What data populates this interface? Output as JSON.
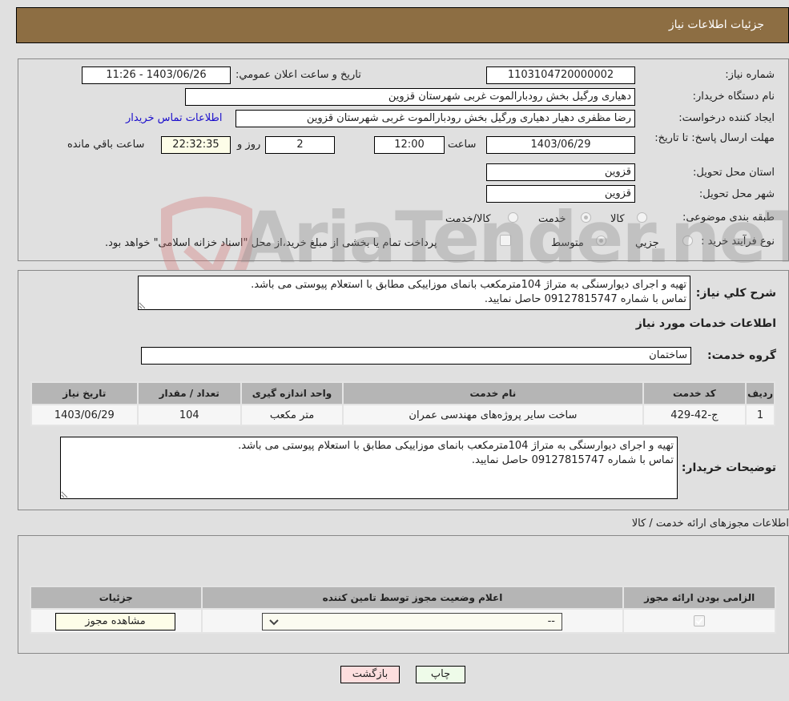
{
  "header": {
    "title": "جزئیات اطلاعات نیاز"
  },
  "form": {
    "need_number_label": "شماره نیاز:",
    "need_number": "1103104720000002",
    "announce_label": "تاريخ و ساعت اعلان عمومي:",
    "announce_value": "1403/06/26 - 11:26",
    "buyer_org_label": "نام دستگاه خريدار:",
    "buyer_org": "دهیاری ورگیل بخش رودبارالموت غربی شهرستان قزوین",
    "creator_label": "ایجاد کننده درخواست:",
    "creator": "رضا مظفری دهیار دهیاری ورگیل بخش رودبارالموت غربی شهرستان قزوین",
    "contact_link": "اطلاعات تماس خريدار",
    "deadline_label": "مهلت ارسال پاسخ: تا تاريخ:",
    "deadline_date": "1403/06/29",
    "time_label": "ساعت",
    "deadline_time": "12:00",
    "days_value": "2",
    "days_label": "روز و",
    "remaining_time": "22:32:35",
    "remaining_label": "ساعت باقي مانده",
    "province_label": "استان محل تحويل:",
    "province": "قزوین",
    "city_label": "شهر محل تحويل:",
    "city": "قزوین",
    "category_label": "طبقه بندی موضوعی:",
    "category_options": [
      "کالا",
      "خدمت",
      "کالا/خدمت"
    ],
    "category_selected": "خدمت",
    "process_label": "نوع فرآیند خرید :",
    "process_options": [
      "جزيي",
      "متوسط"
    ],
    "process_selected": "متوسط",
    "treasury_note": "پرداخت تمام يا بخشی از مبلغ خريد،از محل \"اسناد خزانه اسلامی\" خواهد بود."
  },
  "description": {
    "label": "شرح کلي نياز:",
    "text": "تهيه و اجرای دیوارسنگی به متراژ 104مترمکعب بانمای موزاییکی مطابق با استعلام پیوستی می باشد.\nتماس با شماره 09127815747 حاصل نمایید."
  },
  "services_section": {
    "title": "اطلاعات خدمات مورد نياز",
    "group_label": "گروه خدمت:",
    "group_value": "ساختمان",
    "table": {
      "headers": [
        "رديف",
        "کد خدمت",
        "نام خدمت",
        "واحد اندازه گيری",
        "تعداد / مقدار",
        "تاريخ نياز"
      ],
      "rows": [
        [
          "1",
          "ج-42-429",
          "ساخت سایر پروژه‌های مهندسی عمران",
          "متر مکعب",
          "104",
          "1403/06/29"
        ]
      ]
    }
  },
  "buyer_notes": {
    "label": "توضيحات خريدار:",
    "text": "تهيه و اجرای دیوارسنگی به متراژ 104مترمکعب بانمای موزاییکی مطابق با استعلام پیوستی می باشد.\nتماس با شماره 09127815747 حاصل نمایید."
  },
  "permits": {
    "title": "اطلاعات مجوزهای ارائه خدمت / کالا",
    "headers": [
      "الزامی بودن ارائه مجوز",
      "اعلام وضعيت مجوز توسط تامين کننده",
      "جزئيات"
    ],
    "row": {
      "required_checked": true,
      "status_value": "--",
      "details_button": "مشاهده مجوز"
    }
  },
  "footer": {
    "print_button": "چاپ",
    "back_button": "بازگشت"
  },
  "watermark": {
    "text": "AriaTender.neT"
  },
  "colors": {
    "header_bg": "#8d6e43",
    "print_bg": "#eefbe9",
    "back_bg": "#fddede",
    "link": "#1a0dcc"
  }
}
